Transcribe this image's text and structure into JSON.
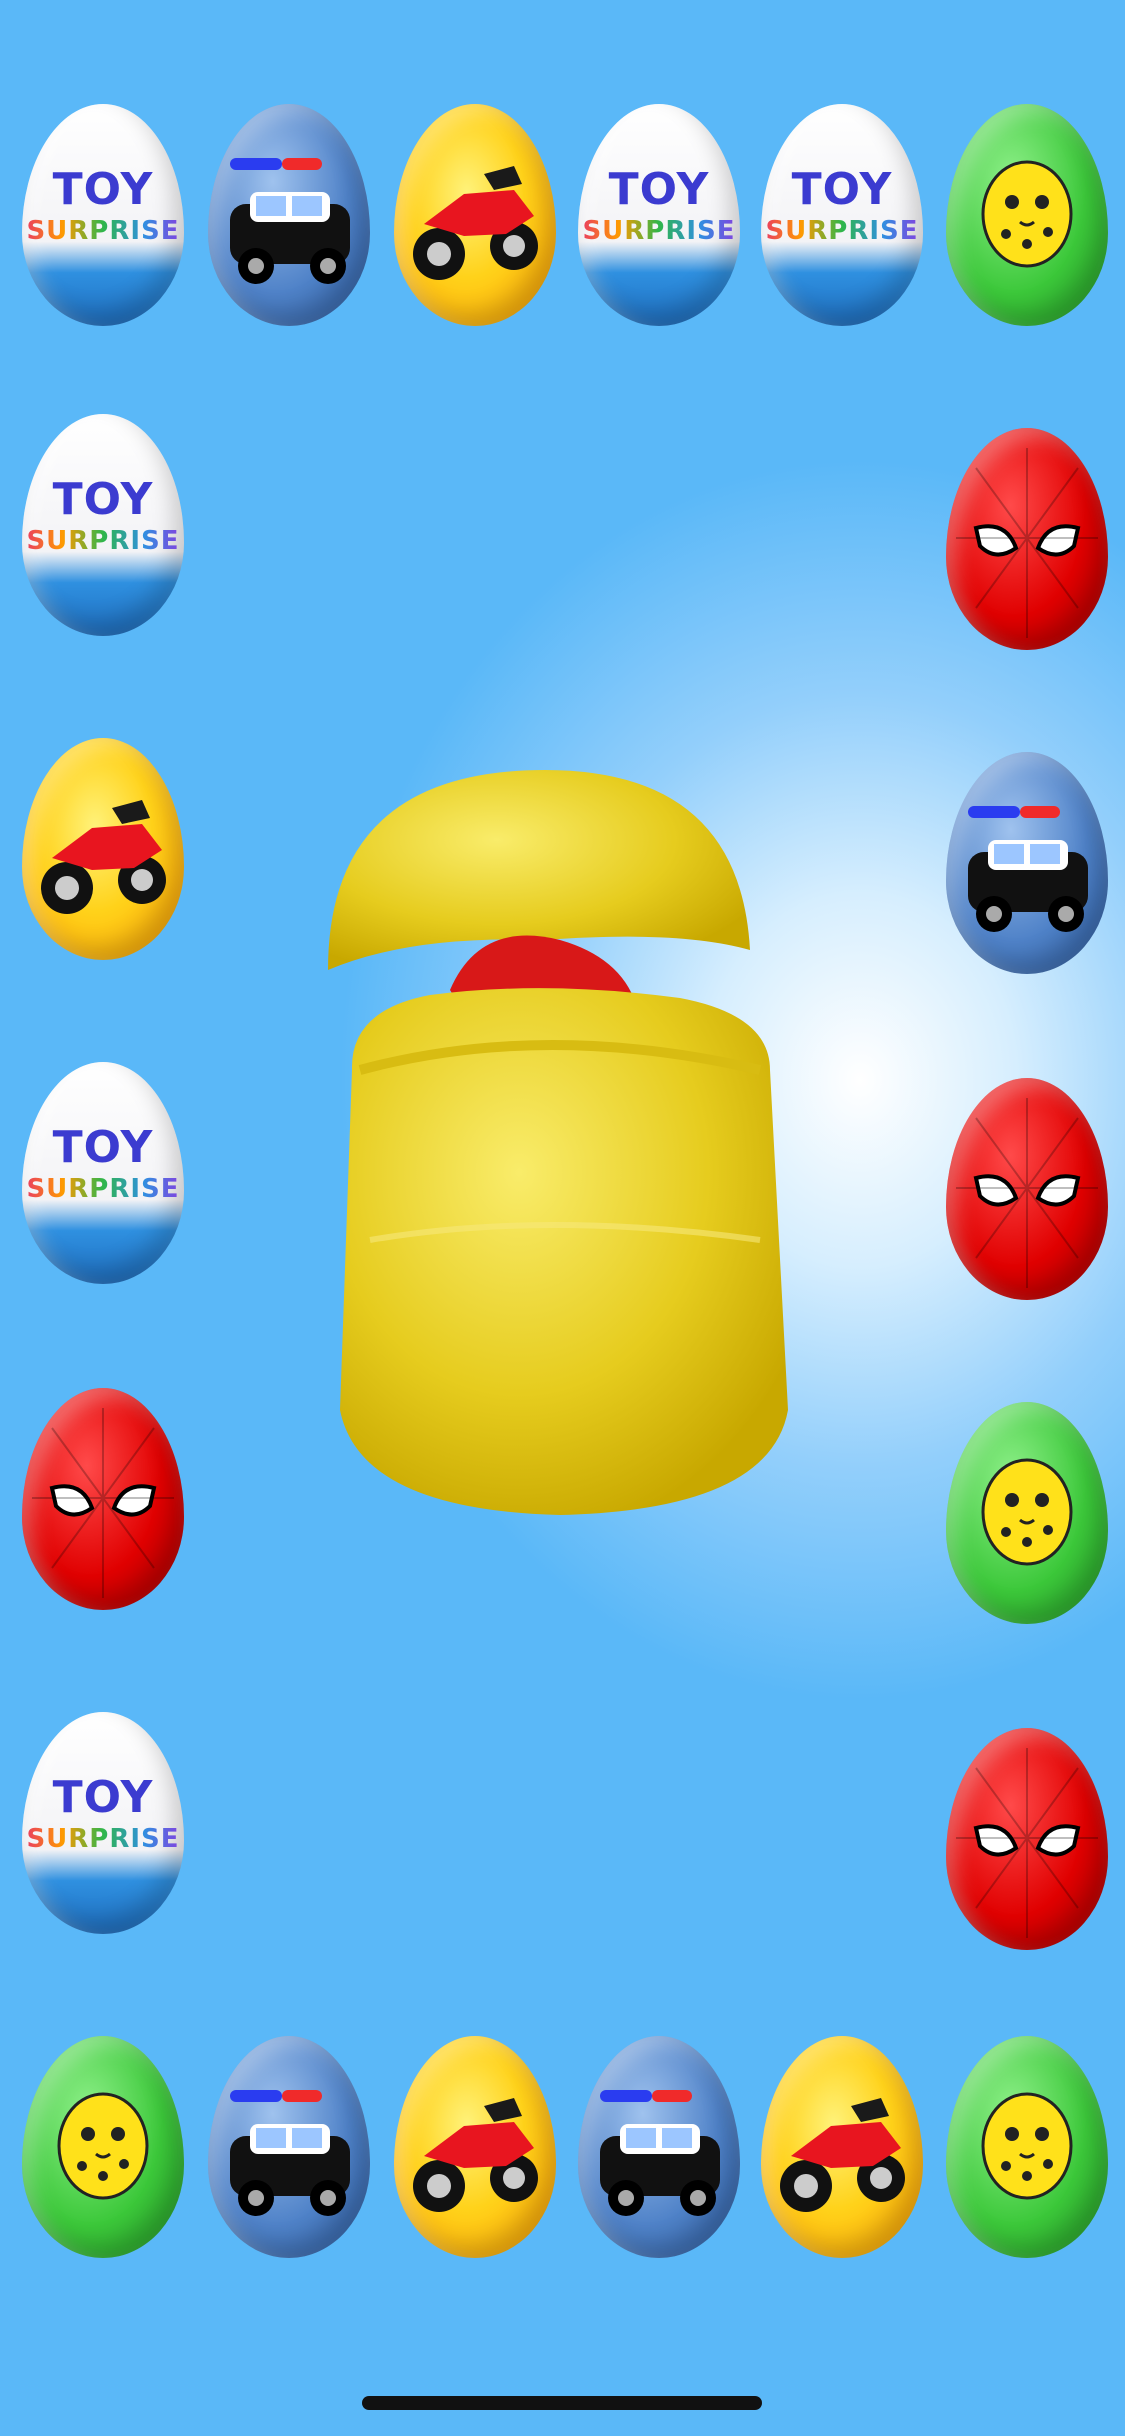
{
  "game": {
    "egg_label_title": "TOY",
    "egg_label_subtitle": "SURPRISE"
  },
  "eggs": {
    "top_row": [
      "toy-surprise",
      "police-car",
      "motorcycle",
      "toy-surprise",
      "toy-surprise",
      "leopard"
    ],
    "left_column": [
      "toy-surprise",
      "motorcycle",
      "toy-surprise",
      "spider",
      "toy-surprise"
    ],
    "right_column": [
      "spider",
      "police-car",
      "spider",
      "leopard",
      "spider"
    ],
    "bottom_row": [
      "leopard",
      "police-car",
      "motorcycle",
      "police-car",
      "motorcycle",
      "leopard"
    ]
  },
  "center_prize": {
    "capsule": "yellow-capsule-open",
    "toy": "red-scooter"
  },
  "colors": {
    "background": "#5ab8f8",
    "toy_egg_band": "#1f6fc0",
    "capsule": "#f2dc3a",
    "spider_egg": "#e00000",
    "leopard_egg": "#3cc83a",
    "moto_egg": "#ffd21a",
    "police_egg": "#4f82c8"
  }
}
